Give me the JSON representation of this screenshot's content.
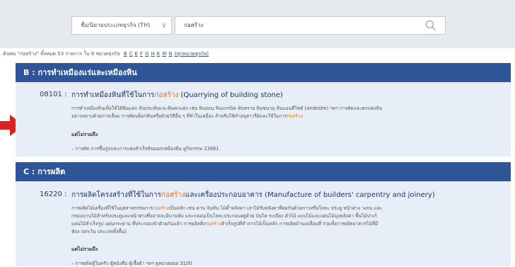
{
  "search": {
    "category_select": "ชื่อ/นิยามประเภทธุรกิจ (TH)",
    "query": "ก่อสร้าง"
  },
  "summary": {
    "text": "ค้นพบ \"ก่อสร้าง\" ทั้งหมด 53 รายการ ใน 9 หมวดธุรกิจ",
    "letters": [
      "B",
      "C",
      "E",
      "F",
      "G",
      "H",
      "K",
      "M",
      "N"
    ],
    "all_link": "(ทุกหมวดธุรกิจ)"
  },
  "sections": [
    {
      "header": "B : การทำเหมืองแร่และเหมืองหิน",
      "items": [
        {
          "code": "08101 :",
          "title_before": "การทำเหมืองหินที่ใช้ในการ",
          "title_hl": "ก่อสร้าง",
          "title_after": " (Quarrying of building stone)",
          "desc_line1": "การทำเหมืองหินเพื่อให้ได้หินแตก หินประดับและหินตกแต่ง เช่น หินอ่อน หินแกรนิต หินทราย หินชนวน หินแอนดีไซต์ (andesite) ฯลฯ การตัดและตกแต่งหิน",
          "desc_line2_before": "อย่างหยาบด้วยการเลื่อย การตัดบล็อกหินหรือด้วยวิธีอื่น ๆ ที่ทำในเหมือง สำหรับใช้ทำอนุสาวรีย์และใช้ในการ",
          "desc_line2_hl": "ก่อสร้าง",
          "except_label": "แต่ไม่รวมถึง",
          "except_item": "– การตัด การขึ้นรูปและการแต่งสำเร็จหินนอกเหมืองหิน ดูกิจกรรม 23961"
        }
      ]
    },
    {
      "header": "C : การผลิต",
      "items": [
        {
          "code": "16220 :",
          "title_before": "การผลิตโครงสร้างที่ใช้ในการ",
          "title_hl": "ก่อสร้าง",
          "title_after": "และเครื่องประกอบอาคาร (Manufacture of builders' carpentry and joinery)",
          "desc_line1_before": "การผลิตไม้เครื่องที่ใช้ในอุตสาหกรรมการ",
          "desc_line1_hl": "ก่อสร้าง",
          "desc_line1_after": "เป็นหลัก เช่น คาน จันทัน ไม้ค้ำหลังคา เสาไม้รับหลังคาที่ต่อกันด้วยกาวหรือโลหะ ประตู หน้าต่าง วงกบ และ",
          "desc_line2": "กรอบบานไม้สำหรับประตูและหน้าต่างซึ่งอาจจะมีบานพับ และกลอนเป็นโลหะประกอบอยู่ด้วย บันได ระเบียง ตัวไม้ แบบไม้และแผ่นไม้มุงหลังคา พื้นไม้ปาเก้",
          "desc_line3_before": "แผ่นไม้สำเร็จรูป แผ่นกระดาน ที่ประกอบเข้าด้วยกันแล้ว การผลิตสิ่ง",
          "desc_line3_hl": "ก่อสร้าง",
          "desc_line3_after": "สำเร็จรูปที่ทำจากไม้เป็นหลัก การผลิตบ้านเคลื่อนที่ รวมทั้งการผลิตอาคารไม้ที่มี",
          "desc_line4": "ห้อง (ยกเว้น ประเภทตั้งพื้น)",
          "except_label": "แต่ไม่รวมถึง",
          "except_item": "– การผลิตตู้ในครัว ตู้หนังสือ ตู้เสื้อผ้า ฯลฯ ดูหมวดย่อย 3100"
        }
      ]
    }
  ],
  "colors": {
    "header_bg": "#2e5597",
    "panel_bg": "#e8eef7",
    "highlight": "#e8741e",
    "arrow": "#e02020"
  }
}
